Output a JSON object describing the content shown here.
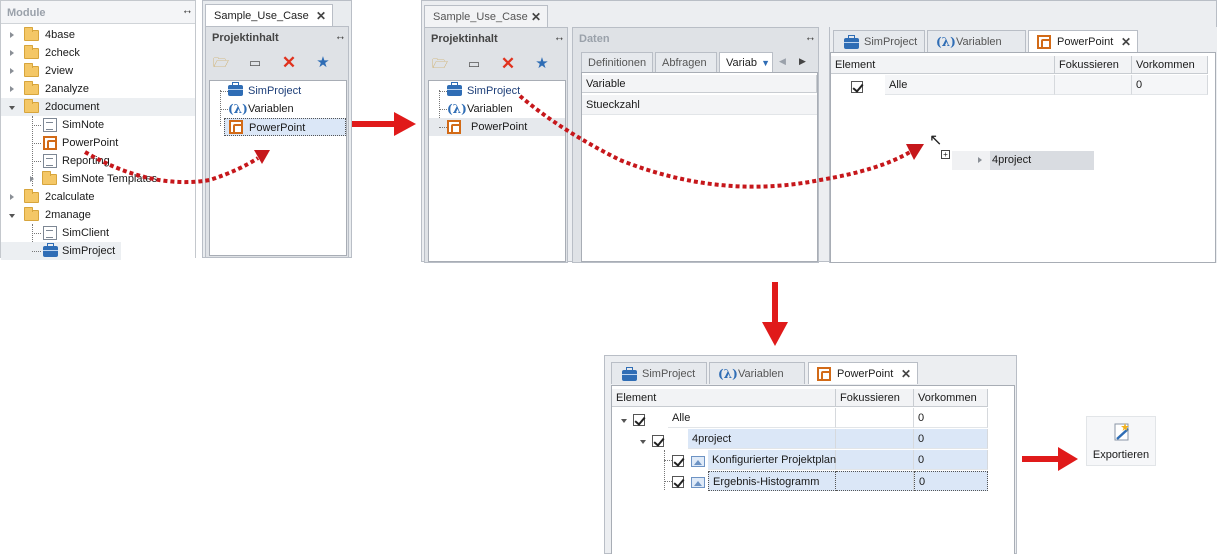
{
  "module_panel": {
    "title": "Module",
    "items": [
      {
        "label": "4base",
        "expanded": false
      },
      {
        "label": "2check",
        "expanded": false
      },
      {
        "label": "2view",
        "expanded": false
      },
      {
        "label": "2analyze",
        "expanded": false
      },
      {
        "label": "2document",
        "expanded": true
      },
      {
        "label": "SimNote"
      },
      {
        "label": "PowerPoint"
      },
      {
        "label": "Reporting"
      },
      {
        "label": "SimNote Templates",
        "expanded": false
      },
      {
        "label": "2calculate",
        "expanded": false
      },
      {
        "label": "2manage",
        "expanded": true
      },
      {
        "label": "SimClient"
      },
      {
        "label": "SimProject"
      }
    ]
  },
  "panel_a": {
    "tab_label": "Sample_Use_Case",
    "header": "Projektinhalt",
    "items": [
      "SimProject",
      "Variablen",
      "PowerPoint"
    ]
  },
  "panel_b": {
    "tab_label": "Sample_Use_Case",
    "header": "Projektinhalt",
    "items": [
      "SimProject",
      "Variablen",
      "PowerPoint"
    ],
    "daten_header": "Daten",
    "daten_tabs": [
      "Definitionen",
      "Abfragen",
      "Variab"
    ],
    "grid_rows": [
      "Variable",
      "Stueckzahl"
    ]
  },
  "ppt_panel_1": {
    "tabs": [
      "SimProject",
      "Variablen",
      "PowerPoint"
    ],
    "columns": [
      "Element",
      "Fokussieren",
      "Vorkommen"
    ],
    "row": {
      "element": "Alle",
      "vorkommen": "0"
    },
    "drag_label": "4project"
  },
  "ppt_panel_2": {
    "tabs": [
      "SimProject",
      "Variablen",
      "PowerPoint"
    ],
    "columns": [
      "Element",
      "Fokussieren",
      "Vorkommen"
    ],
    "rows": [
      {
        "element": "Alle",
        "vorkommen": "0"
      },
      {
        "element": "4project",
        "vorkommen": "0"
      },
      {
        "element": "Konfigurierter Projektplan",
        "vorkommen": "0"
      },
      {
        "element": "Ergebnis-Histogramm",
        "vorkommen": "0"
      }
    ]
  },
  "export_button": {
    "label": "Exportieren"
  },
  "colors": {
    "arrow": "#e01a1a",
    "ppt_orange": "#d26a17",
    "project_blue": "#2f6db5"
  }
}
